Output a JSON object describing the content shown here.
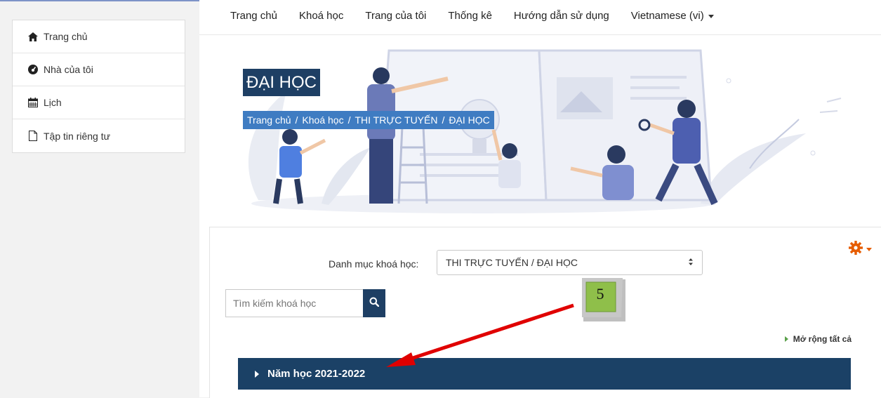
{
  "sidebar": {
    "items": [
      {
        "label": "Trang chủ",
        "icon": "home-icon"
      },
      {
        "label": "Nhà của tôi",
        "icon": "dashboard-icon"
      },
      {
        "label": "Lịch",
        "icon": "calendar-icon"
      },
      {
        "label": "Tập tin riêng tư",
        "icon": "file-icon"
      }
    ]
  },
  "topnav": {
    "items": [
      "Trang chủ",
      "Khoá học",
      "Trang của tôi",
      "Thống kê",
      "Hướng dẫn sử dụng"
    ],
    "language": "Vietnamese (vi)"
  },
  "header": {
    "title": "ĐẠI HỌC",
    "breadcrumb": [
      "Trang chủ",
      "Khoá học",
      "THI TRỰC TUYẾN",
      "ĐẠI HỌC"
    ],
    "breadcrumb_separator": "/"
  },
  "courses": {
    "category_label": "Danh mục khoá học:",
    "category_value": "THI TRỰC TUYẾN / ĐẠI HỌC",
    "search_placeholder": "Tìm kiếm khoá học",
    "expand_all": "Mở rộng tất cả",
    "year_section": "Năm học 2021-2022"
  },
  "annotation": {
    "step_number": "5"
  },
  "colors": {
    "brand_dark": "#1b4166",
    "breadcrumb_bg": "#3f7cc2",
    "gear": "#e65c00",
    "arrow": "#e00000",
    "badge": "#8fbf4a"
  }
}
